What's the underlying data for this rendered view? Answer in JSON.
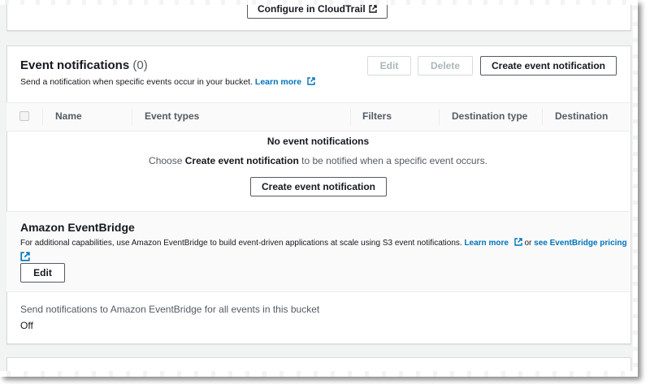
{
  "cloudtrail": {
    "configure_button": "Configure in CloudTrail"
  },
  "event_notifications": {
    "title": "Event notifications",
    "count": "(0)",
    "description": "Send a notification when specific events occur in your bucket.",
    "learn_more": "Learn more",
    "edit_button": "Edit",
    "delete_button": "Delete",
    "create_button": "Create event notification",
    "columns": [
      "Name",
      "Event types",
      "Filters",
      "Destination type",
      "Destination"
    ],
    "empty_title": "No event notifications",
    "empty_prefix": "Choose",
    "empty_bold": "Create event notification",
    "empty_suffix": "to be notified when a specific event occurs.",
    "empty_create_button": "Create event notification"
  },
  "eventbridge": {
    "title": "Amazon EventBridge",
    "description": "For additional capabilities, use Amazon EventBridge to build event-driven applications at scale using S3 event notifications.",
    "learn_more": "Learn more",
    "or_text": "or",
    "pricing_link": "see EventBridge pricing",
    "edit_button": "Edit",
    "setting_label": "Send notifications to Amazon EventBridge for all events in this bucket",
    "setting_value": "Off"
  },
  "colors": {
    "link": "#0073bb",
    "border": "#d5dbdb",
    "background": "#f2f3f3"
  }
}
